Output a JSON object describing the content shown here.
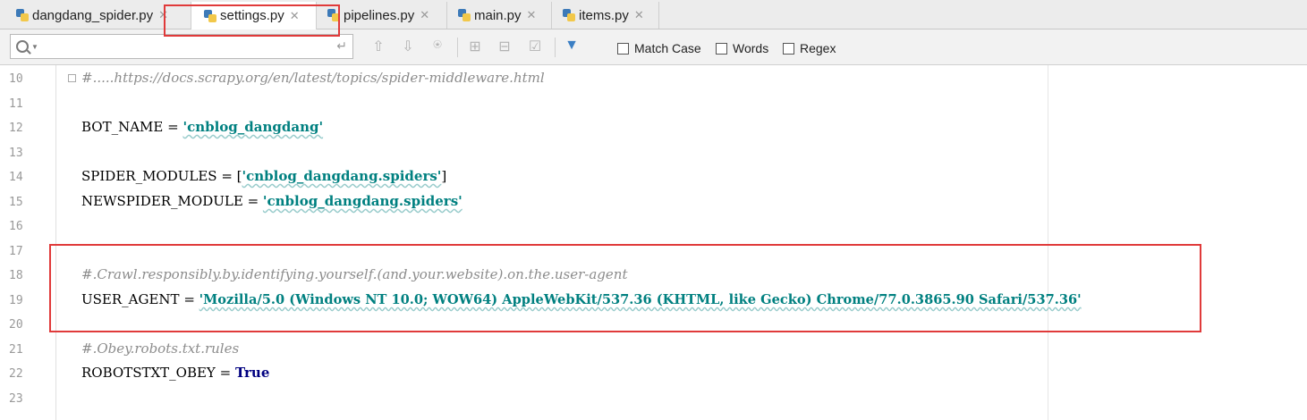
{
  "tabs": [
    {
      "label": "dangdang_spider.py",
      "active": false
    },
    {
      "label": "settings.py",
      "active": true
    },
    {
      "label": "pipelines.py",
      "active": false
    },
    {
      "label": "main.py",
      "active": false
    },
    {
      "label": "items.py",
      "active": false
    }
  ],
  "search": {
    "value": "",
    "options": {
      "match_case": "Match Case",
      "words": "Words",
      "regex": "Regex"
    }
  },
  "lines": [
    {
      "n": "10",
      "text": "#.....https://docs.scrapy.org/en/latest/topics/spider-middleware.html"
    },
    {
      "n": "11",
      "text": ""
    },
    {
      "n": "12",
      "text": "BOT_NAME = 'cnblog_dangdang'"
    },
    {
      "n": "13",
      "text": ""
    },
    {
      "n": "14",
      "text": "SPIDER_MODULES = ['cnblog_dangdang.spiders']"
    },
    {
      "n": "15",
      "text": "NEWSPIDER_MODULE = 'cnblog_dangdang.spiders'"
    },
    {
      "n": "16",
      "text": ""
    },
    {
      "n": "17",
      "text": ""
    },
    {
      "n": "18",
      "text": "#.Crawl.responsibly.by.identifying.yourself.(and.your.website).on.the.user-agent"
    },
    {
      "n": "19",
      "text": "USER_AGENT = 'Mozilla/5.0 (Windows NT 10.0; WOW64) AppleWebKit/537.36 (KHTML, like Gecko) Chrome/77.0.3865.90 Safari/537.36'"
    },
    {
      "n": "20",
      "text": ""
    },
    {
      "n": "21",
      "text": "#.Obey.robots.txt.rules"
    },
    {
      "n": "22",
      "text": "ROBOTSTXT_OBEY = True"
    },
    {
      "n": "23",
      "text": ""
    }
  ],
  "code": {
    "l10": "#.....https://docs.scrapy.org/en/latest/topics/spider-middleware.html",
    "l12_name": "BOT_NAME",
    "l12_eq": " = ",
    "l12_str": "'cnblog_dangdang'",
    "l14_name": "SPIDER_MODULES",
    "l14_eq": " = [",
    "l14_str": "'cnblog_dangdang.spiders'",
    "l14_end": "]",
    "l15_name": "NEWSPIDER_MODULE",
    "l15_eq": " = ",
    "l15_str": "'cnblog_dangdang.spiders'",
    "l18": "#.Crawl.responsibly.by.identifying.yourself.(and.your.website).on.the.user-agent",
    "l19_name": "USER_AGENT",
    "l19_eq": " = ",
    "l19_str": "'Mozilla/5.0 (Windows NT 10.0; WOW64) AppleWebKit/537.36 (KHTML, like Gecko) Chrome/77.0.3865.90 Safari/537.36'",
    "l21": "#.Obey.robots.txt.rules",
    "l22_name": "ROBOTSTXT_OBEY",
    "l22_eq": " = ",
    "l22_kw": "True"
  },
  "colors": {
    "highlight": "#e03a3a",
    "string": "#008080",
    "keyword": "#000080",
    "comment": "#8c8c8c"
  }
}
